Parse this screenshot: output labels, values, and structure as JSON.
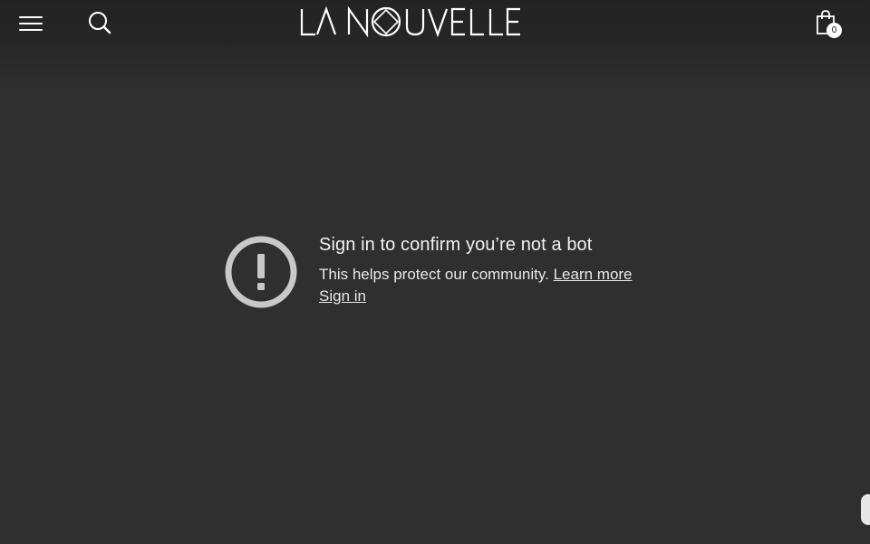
{
  "header": {
    "logo_text": "LA NOUVELLE",
    "cart_count": "0"
  },
  "error": {
    "title": "Sign in to confirm you’re not a bot",
    "message": "This helps protect our community.",
    "learn_more": "Learn more",
    "sign_in": "Sign in"
  },
  "colors": {
    "background": "#2f2f2f",
    "header": "#232323",
    "text": "#ffffff",
    "icon": "#c8c8c8"
  }
}
